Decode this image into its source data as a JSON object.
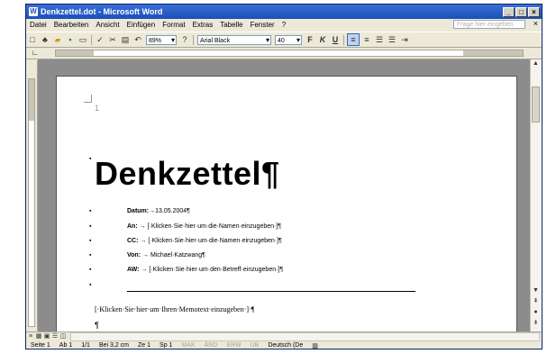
{
  "window": {
    "title": "Denkzettel.dot - Microsoft Word",
    "buttons": [
      "_",
      "□",
      "×"
    ]
  },
  "menubar": {
    "items": [
      "Datei",
      "Bearbeiten",
      "Ansicht",
      "Einfügen",
      "Format",
      "Extras",
      "Tabelle",
      "Fenster",
      "?"
    ],
    "help_placeholder": "Frage hier eingeben",
    "close": "×"
  },
  "toolbar": {
    "zoom": "89%",
    "font": "Arial Black",
    "size": "40",
    "bold": "F",
    "italic": "K",
    "underline": "U"
  },
  "document": {
    "page_number": "1",
    "heading": "Denkzettel¶",
    "fields": [
      {
        "label": "Datum:",
        "arrow": "→",
        "value": "13.05.2004¶"
      },
      {
        "label": "An:",
        "arrow": "→",
        "value": "[·Klicken·Sie·hier·um·die·Namen·einzugeben·]¶"
      },
      {
        "label": "CC:",
        "arrow": "→",
        "value": "[·Klicken·Sie·hier·um·die·Namen·einzugeben·]¶"
      },
      {
        "label": "Von:",
        "arrow": "→",
        "value": "Michael·Katzwang¶"
      },
      {
        "label": "AW:",
        "arrow": "→",
        "value": "[·Klicken·Sie·hier·um·den·Betreff·einzugeben·]¶"
      }
    ],
    "memo": "[·Klicken·Sie·hier·um·Ihren·Memotext·einzugeben·]·¶",
    "last_para": "¶"
  },
  "statusbar": {
    "seite": "Seite 1",
    "ab": "Ab 1",
    "pages": "1/1",
    "bei": "Bei 3,2 cm",
    "ze": "Ze 1",
    "sp": "Sp 1",
    "mak": "MAK",
    "aend": "ÄND",
    "erw": "ERW",
    "ub": "ÜB",
    "lang": "Deutsch (De"
  }
}
